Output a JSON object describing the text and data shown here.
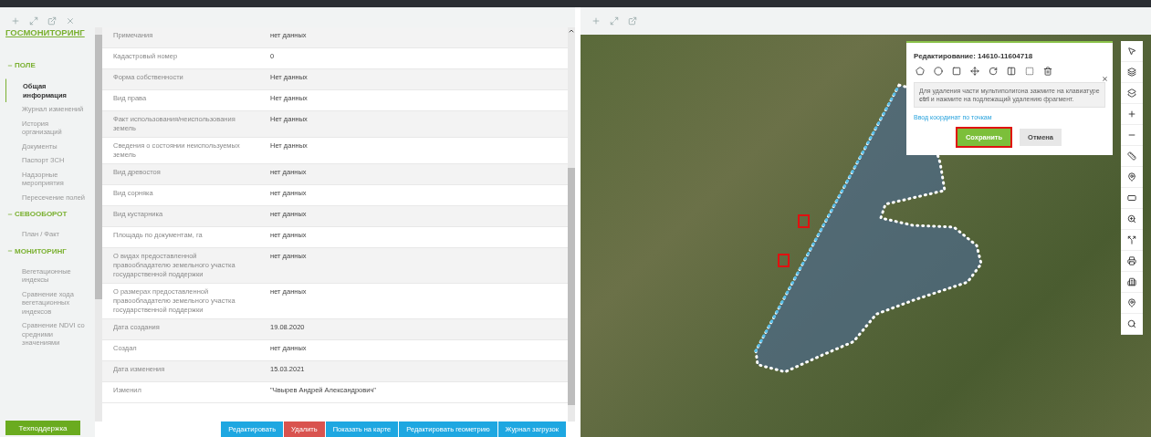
{
  "sidebar": {
    "brand": "ГОСМОНИТОРИНГ",
    "sections": [
      {
        "title": "ПОЛЕ",
        "expanded": true,
        "items": [
          {
            "label": "Общая информация",
            "selected": true
          },
          {
            "label": "Журнал изменений",
            "selected": false
          },
          {
            "label": "История организаций",
            "selected": false
          },
          {
            "label": "Документы",
            "selected": false
          },
          {
            "label": "Паспорт ЗСН",
            "selected": false
          },
          {
            "label": "Надзорные мероприятия",
            "selected": false
          },
          {
            "label": "Пересечение полей",
            "selected": false
          }
        ]
      },
      {
        "title": "СЕВООБОРОТ",
        "expanded": true,
        "items": [
          {
            "label": "План / Факт",
            "selected": false
          }
        ]
      },
      {
        "title": "МОНИТОРИНГ",
        "expanded": true,
        "items": [
          {
            "label": "Вегетационные индексы",
            "selected": false
          },
          {
            "label": "Сравнение хода вегетационных индексов",
            "selected": false
          },
          {
            "label": "Сравнение NDVI со средними значениями",
            "selected": false
          }
        ]
      }
    ],
    "support_button": "Техподдержка"
  },
  "table": {
    "rows": [
      {
        "label": "Примечания",
        "value": "нет данных"
      },
      {
        "label": "Кадастровый номер",
        "value": "0"
      },
      {
        "label": "Форма собственности",
        "value": "Нет данных"
      },
      {
        "label": "Вид права",
        "value": "Нет данных"
      },
      {
        "label": "Факт использования/неиспользования земель",
        "value": "Нет данных"
      },
      {
        "label": "Сведения о состоянии неиспользуемых земель",
        "value": "Нет данных"
      },
      {
        "label": "Вид древостоя",
        "value": "нет данных"
      },
      {
        "label": "Вид сорняка",
        "value": "нет данных"
      },
      {
        "label": "Вид кустарника",
        "value": "нет данных"
      },
      {
        "label": "Площадь по документам, га",
        "value": "нет данных"
      },
      {
        "label": "О видах предоставленной правообладателю земельного участка государственной поддержки",
        "value": "нет данных"
      },
      {
        "label": "О размерах предоставленной правообладателю земельного участка государственной поддержки",
        "value": "нет данных"
      },
      {
        "label": "Дата создания",
        "value": "19.08.2020"
      },
      {
        "label": "Создал",
        "value": "нет данных"
      },
      {
        "label": "Дата изменения",
        "value": "15.03.2021"
      },
      {
        "label": "Изменил",
        "value": "\"Чвырев Андрей Александрович\""
      }
    ]
  },
  "actions": [
    {
      "label": "Редактировать",
      "kind": "primary"
    },
    {
      "label": "Удалить",
      "kind": "danger"
    },
    {
      "label": "Показать на карте",
      "kind": "primary"
    },
    {
      "label": "Редактировать геометрию",
      "kind": "primary"
    },
    {
      "label": "Журнал загрузок",
      "kind": "primary"
    }
  ],
  "editor": {
    "title": "Редактирование: 14610-11604718",
    "hint": "Для удаления части мультиполигона зажмите на клавиатуре **ctrl** и нажмите на подлежащий удалению фрагмент.",
    "link": "Ввод координат по точкам",
    "buttons": [
      {
        "label": "Сохранить",
        "kind": "save",
        "highlighted": true
      },
      {
        "label": "Отмена",
        "kind": "cancel",
        "highlighted": false
      }
    ]
  }
}
